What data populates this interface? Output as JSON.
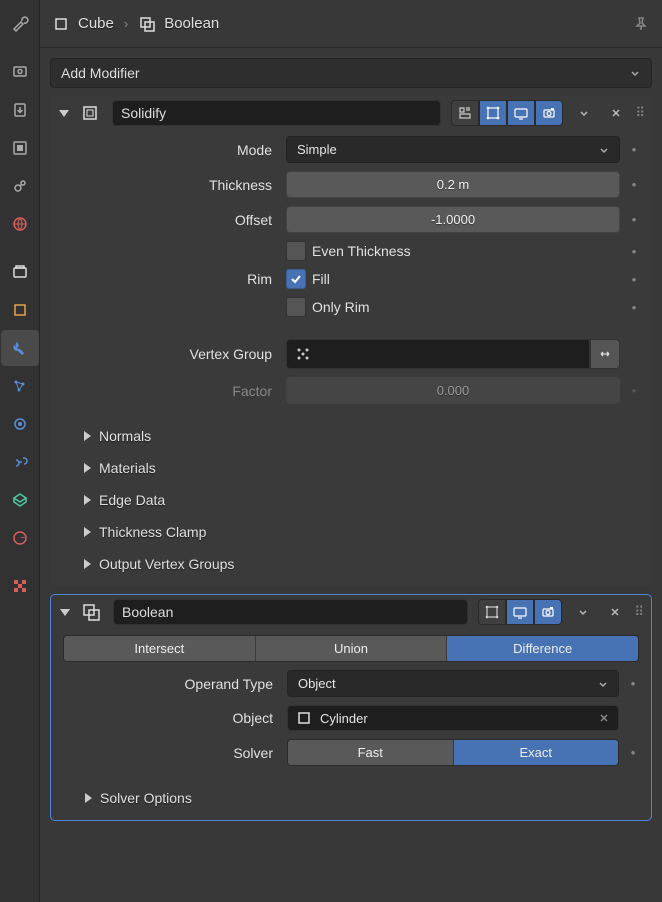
{
  "breadcrumb": {
    "object": "Cube",
    "modifier": "Boolean"
  },
  "add_modifier_label": "Add Modifier",
  "modifiers": [
    {
      "name": "Solidify",
      "toggles": {
        "edit": false,
        "cage": true,
        "realtime": true,
        "render": true
      },
      "fields": {
        "mode_label": "Mode",
        "mode_value": "Simple",
        "thickness_label": "Thickness",
        "thickness_value": "0.2 m",
        "offset_label": "Offset",
        "offset_value": "-1.0000",
        "even_thickness_label": "Even Thickness",
        "even_thickness_checked": false,
        "rim_label": "Rim",
        "fill_label": "Fill",
        "fill_checked": true,
        "only_rim_label": "Only Rim",
        "only_rim_checked": false,
        "vertex_group_label": "Vertex Group",
        "factor_label": "Factor",
        "factor_value": "0.000"
      },
      "subpanels": [
        "Normals",
        "Materials",
        "Edge Data",
        "Thickness Clamp",
        "Output Vertex Groups"
      ]
    },
    {
      "name": "Boolean",
      "toggles": {
        "edit": false,
        "realtime": true,
        "render": true
      },
      "operation": {
        "options": [
          "Intersect",
          "Union",
          "Difference"
        ],
        "active": 2
      },
      "fields": {
        "operand_label": "Operand Type",
        "operand_value": "Object",
        "object_label": "Object",
        "object_value": "Cylinder",
        "solver_label": "Solver",
        "solver_options": [
          "Fast",
          "Exact"
        ],
        "solver_active": 1
      },
      "subpanels": [
        "Solver Options"
      ]
    }
  ],
  "tab_icons": [
    "tool",
    "render",
    "output",
    "viewlayer",
    "scene",
    "world",
    "",
    "collection",
    "object",
    "modifier",
    "particle",
    "physics",
    "constraint",
    "data",
    "material",
    "texture"
  ]
}
